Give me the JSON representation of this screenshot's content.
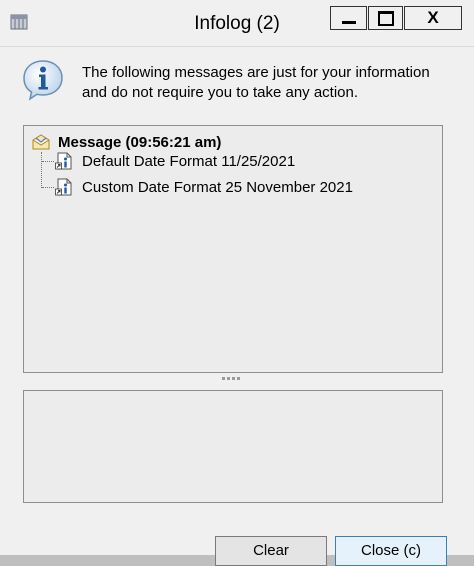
{
  "window": {
    "title": "Infolog (2)",
    "controls": {
      "minimize": "minimize",
      "maximize": "maximize",
      "close_glyph": "X"
    }
  },
  "info": {
    "icon": "info-icon",
    "text": "The following messages are just for your information and do not require you to take any action."
  },
  "tree": {
    "root": {
      "icon": "message-envelope-icon",
      "label": "Message (09:56:21 am)"
    },
    "children": [
      {
        "icon": "info-document-icon",
        "label": "Default Date Format 11/25/2021"
      },
      {
        "icon": "info-document-icon",
        "label": "Custom Date Format 25 November 2021"
      }
    ]
  },
  "buttons": {
    "clear": "Clear",
    "close": "Close (c)"
  },
  "colors": {
    "accent": "#3c7fb1",
    "panel": "#ececec",
    "window": "#f0f0f0"
  }
}
